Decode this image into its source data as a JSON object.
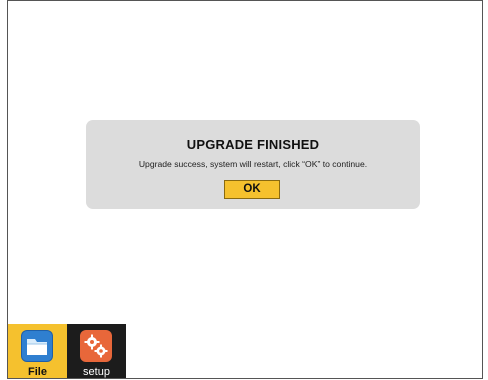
{
  "dialog": {
    "title": "UPGRADE FINISHED",
    "message": "Upgrade success, system will restart, click “OK” to continue.",
    "ok_label": "OK"
  },
  "taskbar": {
    "items": [
      {
        "label": "File",
        "icon": "folder-icon",
        "active": true
      },
      {
        "label": "setup",
        "icon": "gear-icon",
        "active": false
      }
    ]
  },
  "colors": {
    "accent": "#f5c12e",
    "dialog_bg": "#dcdcdc",
    "setup_icon": "#e8673a",
    "folder_icon": "#2f7fd0"
  }
}
